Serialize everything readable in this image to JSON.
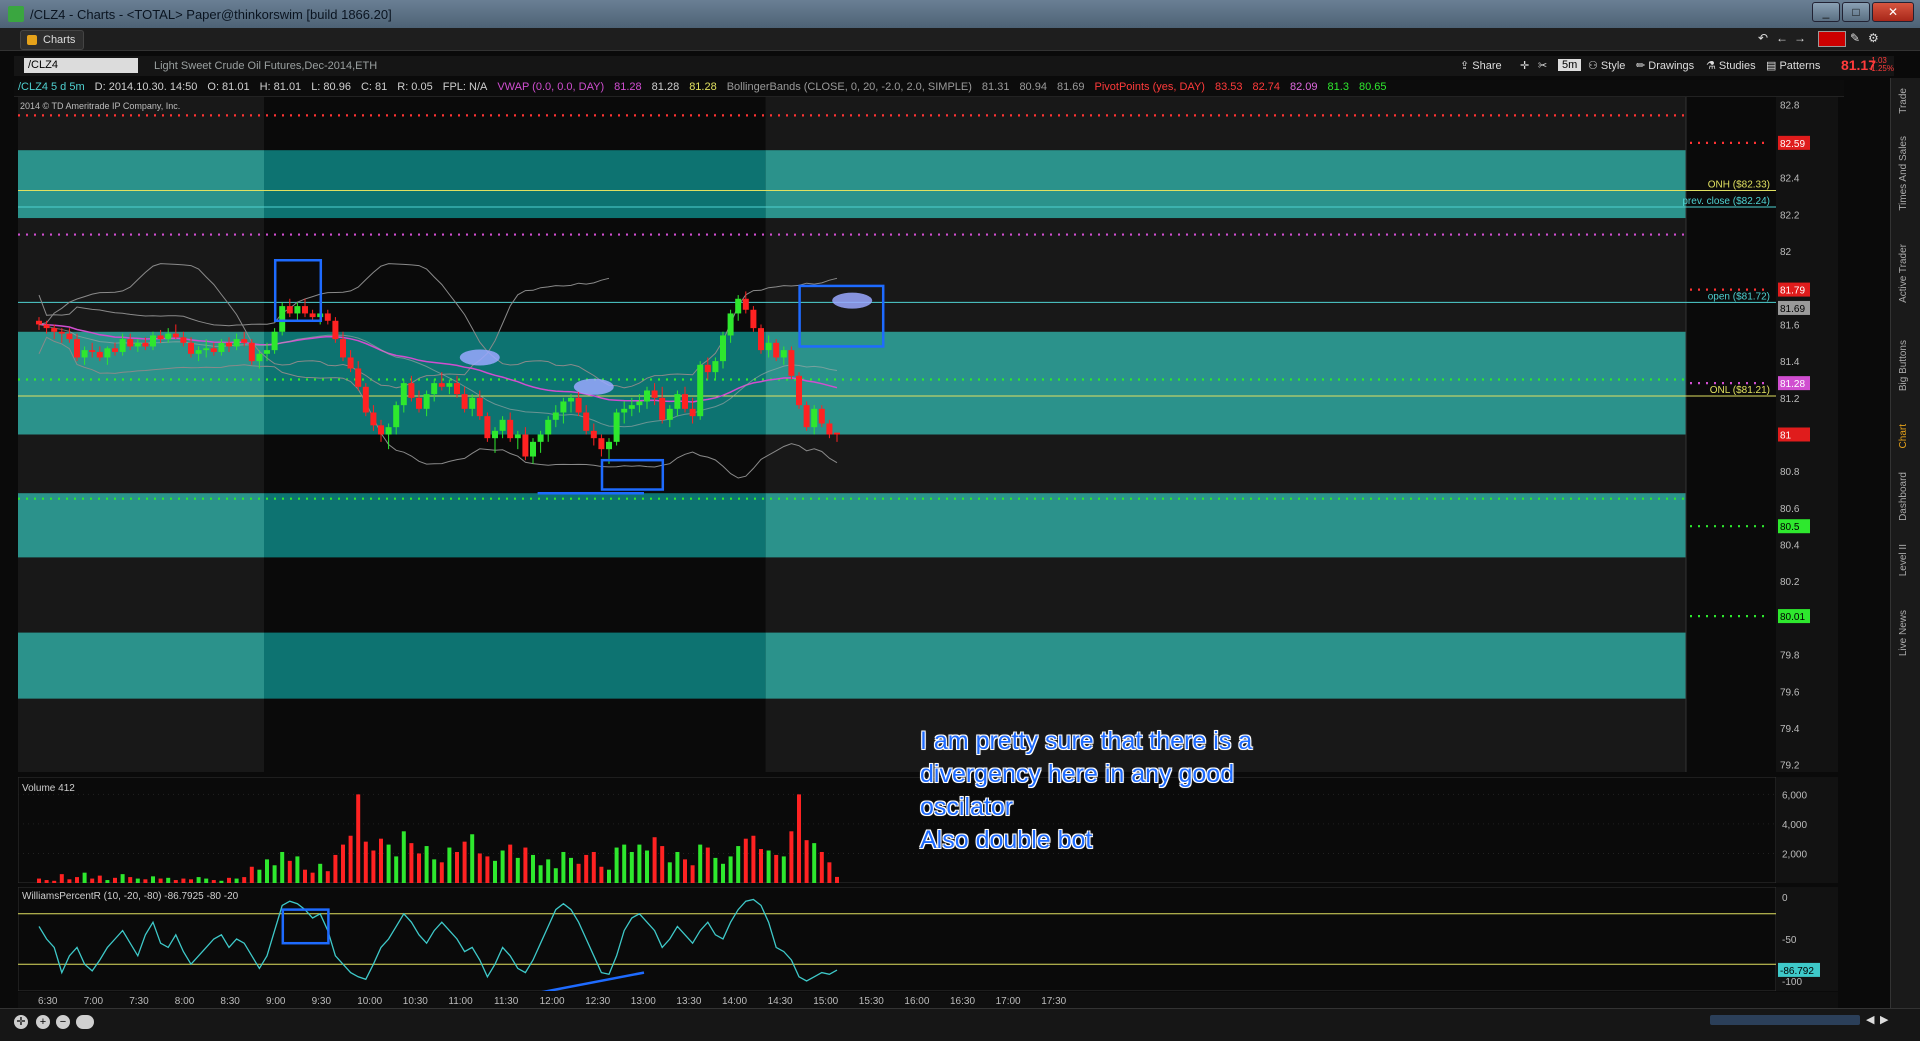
{
  "window": {
    "title": "/CLZ4 - Charts - <TOTAL> Paper@thinkorswim [build 1866.20]"
  },
  "tabs": {
    "charts": "Charts"
  },
  "symbol": {
    "value": "/CLZ4",
    "description": "Light Sweet Crude Oil Futures,Dec-2014,ETH",
    "last_price": "81.17",
    "change_line1": "-1.03",
    "change_line2": "-1.25%"
  },
  "toolbar": {
    "share": "Share",
    "timeframe": "5m",
    "style": "Style",
    "drawings": "Drawings",
    "studies": "Studies",
    "patterns": "Patterns"
  },
  "infobar": {
    "items": [
      {
        "text": "/CLZ4 5 d 5m",
        "color": "#4fd1d1"
      },
      {
        "text": "D: 2014.10.30. 14:50",
        "color": "#cfcfcf"
      },
      {
        "text": "O: 81.01",
        "color": "#cfcfcf"
      },
      {
        "text": "H: 81.01",
        "color": "#cfcfcf"
      },
      {
        "text": "L: 80.96",
        "color": "#cfcfcf"
      },
      {
        "text": "C: 81",
        "color": "#cfcfcf"
      },
      {
        "text": "R: 0.05",
        "color": "#cfcfcf"
      },
      {
        "text": "FPL: N/A",
        "color": "#cfcfcf"
      },
      {
        "text": "VWAP (0.0, 0.0, DAY)",
        "color": "#d04ed0"
      },
      {
        "text": "81.28",
        "color": "#d04ed0"
      },
      {
        "text": "81.28",
        "color": "#cfcfcf"
      },
      {
        "text": "81.28",
        "color": "#e0e060"
      },
      {
        "text": "BollingerBands (CLOSE, 0, 20, -2.0, 2.0, SIMPLE)",
        "color": "#9a9a9a"
      },
      {
        "text": "81.31",
        "color": "#9a9a9a"
      },
      {
        "text": "80.94",
        "color": "#9a9a9a"
      },
      {
        "text": "81.69",
        "color": "#9a9a9a"
      },
      {
        "text": "PivotPoints (yes, DAY)",
        "color": "#ff3b3b"
      },
      {
        "text": "83.53",
        "color": "#ff3b3b"
      },
      {
        "text": "82.74",
        "color": "#ff3b3b"
      },
      {
        "text": "82.09",
        "color": "#e06ae0"
      },
      {
        "text": "81.3",
        "color": "#2ee82e"
      },
      {
        "text": "80.65",
        "color": "#2ee82e"
      }
    ]
  },
  "copyright": "2014 © TD Ameritrade IP Company, Inc.",
  "price_axis": {
    "ticks": [
      "82.8",
      "82.6",
      "82.4",
      "82.2",
      "82",
      "81.8",
      "81.6",
      "81.4",
      "81.2",
      "81",
      "80.8",
      "80.6",
      "80.4",
      "80.2",
      "80",
      "79.8",
      "79.6",
      "79.4",
      "79.2"
    ]
  },
  "price_markers": [
    {
      "label": "82.59",
      "value": 82.59,
      "bg": "#e01c1c",
      "fg": "#ffffff",
      "dot": "#ff3333"
    },
    {
      "label": "81.79",
      "value": 81.79,
      "bg": "#e01c1c",
      "fg": "#ffffff",
      "dot": "#ff3333"
    },
    {
      "label": "81.69",
      "value": 81.69,
      "bg": "#9a9a9a",
      "fg": "#000000",
      "dot": ""
    },
    {
      "label": "81.28",
      "value": 81.28,
      "bg": "#d04ed0",
      "fg": "#ffffff",
      "dot": "#d04ed0"
    },
    {
      "label": "81",
      "value": 81.0,
      "bg": "#e01c1c",
      "fg": "#ffffff",
      "dot": ""
    },
    {
      "label": "80.5",
      "value": 80.5,
      "bg": "#2ee82e",
      "fg": "#000000",
      "dot": "#2ee82e"
    },
    {
      "label": "80.01",
      "value": 80.01,
      "bg": "#2ee82e",
      "fg": "#000000",
      "dot": "#2ee82e"
    }
  ],
  "level_lines": [
    {
      "label": "ONH ($82.33)",
      "value": 82.33,
      "color": "#e0e060"
    },
    {
      "label": "prev. close ($82.24)",
      "value": 82.24,
      "color": "#4fd1d1"
    },
    {
      "label": "open ($81.72)",
      "value": 81.72,
      "color": "#4fd1d1"
    },
    {
      "label": "ONL ($81.21)",
      "value": 81.21,
      "color": "#e0e060"
    }
  ],
  "time_axis": {
    "ticks": [
      "6:30",
      "7:00",
      "7:30",
      "8:00",
      "8:30",
      "9:00",
      "9:30",
      "10:00",
      "10:30",
      "11:00",
      "11:30",
      "12:00",
      "12:30",
      "13:00",
      "13:30",
      "14:00",
      "14:30",
      "15:00",
      "15:30",
      "16:00",
      "16:30",
      "17:00",
      "17:30"
    ]
  },
  "volume": {
    "label": "Volume",
    "value": "412",
    "ticks": [
      "6,000",
      "4,000",
      "2,000"
    ]
  },
  "williams": {
    "label": "WilliamsPercentR (10, -20, -80)",
    "value": "-86.7925",
    "low": "-80",
    "high": "-20",
    "ticks": [
      "0",
      "-50",
      "-100"
    ],
    "badge": "-86.792"
  },
  "annotation": {
    "lines": [
      "I am pretty sure that there is a",
      "divergency here in any good",
      "oscilator",
      "Also double bot"
    ]
  },
  "side_tabs": [
    "Trade",
    "Times And Sales",
    "Active Trader",
    "Big Buttons",
    "Chart",
    "Dashboard",
    "Level II",
    "Live News"
  ],
  "colors": {
    "up": "#2ee82e",
    "down": "#ff2222",
    "teal_band": "#1e8c84",
    "rth_band": "#0d7371",
    "vwap": "#d04ed0",
    "bollinger": "#8a8a8a",
    "williams": "#3ec9c9",
    "annotation": "#1e6bff"
  },
  "chart_data": {
    "type": "candlestick",
    "bar_interval": "5m",
    "start_time": "6:30",
    "ohlc": [
      [
        81.62,
        81.64,
        81.57,
        81.6
      ],
      [
        81.6,
        81.62,
        81.55,
        81.58
      ],
      [
        81.58,
        81.6,
        81.52,
        81.56
      ],
      [
        81.56,
        81.58,
        81.5,
        81.55
      ],
      [
        81.55,
        81.58,
        81.5,
        81.52
      ],
      [
        81.52,
        81.55,
        81.4,
        81.42
      ],
      [
        81.42,
        81.48,
        81.38,
        81.46
      ],
      [
        81.46,
        81.5,
        81.42,
        81.45
      ],
      [
        81.45,
        81.48,
        81.4,
        81.42
      ],
      [
        81.42,
        81.48,
        81.38,
        81.47
      ],
      [
        81.47,
        81.5,
        81.43,
        81.45
      ],
      [
        81.45,
        81.55,
        81.43,
        81.52
      ],
      [
        81.52,
        81.55,
        81.46,
        81.48
      ],
      [
        81.48,
        81.52,
        81.45,
        81.5
      ],
      [
        81.5,
        81.53,
        81.46,
        81.48
      ],
      [
        81.48,
        81.56,
        81.46,
        81.54
      ],
      [
        81.54,
        81.57,
        81.5,
        81.52
      ],
      [
        81.52,
        81.58,
        81.5,
        81.55
      ],
      [
        81.55,
        81.6,
        81.52,
        81.53
      ],
      [
        81.53,
        81.56,
        81.48,
        81.5
      ],
      [
        81.5,
        81.53,
        81.42,
        81.44
      ],
      [
        81.44,
        81.48,
        81.4,
        81.46
      ],
      [
        81.46,
        81.52,
        81.42,
        81.47
      ],
      [
        81.47,
        81.5,
        81.43,
        81.45
      ],
      [
        81.45,
        81.52,
        81.43,
        81.5
      ],
      [
        81.5,
        81.53,
        81.45,
        81.48
      ],
      [
        81.48,
        81.55,
        81.46,
        81.52
      ],
      [
        81.52,
        81.56,
        81.48,
        81.5
      ],
      [
        81.5,
        81.52,
        81.38,
        81.4
      ],
      [
        81.4,
        81.46,
        81.36,
        81.44
      ],
      [
        81.44,
        81.5,
        81.4,
        81.46
      ],
      [
        81.46,
        81.58,
        81.44,
        81.56
      ],
      [
        81.56,
        81.72,
        81.54,
        81.7
      ],
      [
        81.7,
        81.74,
        81.64,
        81.66
      ],
      [
        81.66,
        81.72,
        81.62,
        81.7
      ],
      [
        81.7,
        81.74,
        81.64,
        81.66
      ],
      [
        81.66,
        81.68,
        81.62,
        81.64
      ],
      [
        81.64,
        81.68,
        81.6,
        81.66
      ],
      [
        81.66,
        81.68,
        81.6,
        81.62
      ],
      [
        81.62,
        81.64,
        81.5,
        81.52
      ],
      [
        81.52,
        81.56,
        81.4,
        81.42
      ],
      [
        81.42,
        81.46,
        81.34,
        81.36
      ],
      [
        81.36,
        81.4,
        81.24,
        81.26
      ],
      [
        81.26,
        81.28,
        81.1,
        81.12
      ],
      [
        81.12,
        81.16,
        81.02,
        81.05
      ],
      [
        81.05,
        81.08,
        80.96,
        81.0
      ],
      [
        81.0,
        81.06,
        80.92,
        81.04
      ],
      [
        81.04,
        81.18,
        81.0,
        81.16
      ],
      [
        81.16,
        81.3,
        81.12,
        81.28
      ],
      [
        81.28,
        81.32,
        81.18,
        81.2
      ],
      [
        81.2,
        81.24,
        81.12,
        81.14
      ],
      [
        81.14,
        81.24,
        81.1,
        81.22
      ],
      [
        81.22,
        81.3,
        81.18,
        81.28
      ],
      [
        81.28,
        81.34,
        81.24,
        81.26
      ],
      [
        81.26,
        81.3,
        81.22,
        81.28
      ],
      [
        81.28,
        81.32,
        81.2,
        81.22
      ],
      [
        81.22,
        81.26,
        81.12,
        81.14
      ],
      [
        81.14,
        81.22,
        81.1,
        81.2
      ],
      [
        81.2,
        81.24,
        81.08,
        81.1
      ],
      [
        81.1,
        81.12,
        80.96,
        80.98
      ],
      [
        80.98,
        81.04,
        80.9,
        81.02
      ],
      [
        81.02,
        81.1,
        80.98,
        81.08
      ],
      [
        81.08,
        81.12,
        80.96,
        80.98
      ],
      [
        80.98,
        81.02,
        80.92,
        81.0
      ],
      [
        81.0,
        81.04,
        80.86,
        80.88
      ],
      [
        80.88,
        80.98,
        80.84,
        80.96
      ],
      [
        80.96,
        81.02,
        80.9,
        81.0
      ],
      [
        81.0,
        81.1,
        80.96,
        81.08
      ],
      [
        81.08,
        81.16,
        81.04,
        81.12
      ],
      [
        81.12,
        81.2,
        81.06,
        81.18
      ],
      [
        81.18,
        81.22,
        81.12,
        81.2
      ],
      [
        81.2,
        81.24,
        81.1,
        81.12
      ],
      [
        81.12,
        81.16,
        81.0,
        81.02
      ],
      [
        81.02,
        81.06,
        80.94,
        80.98
      ],
      [
        80.98,
        81.0,
        80.88,
        80.92
      ],
      [
        80.92,
        80.98,
        80.84,
        80.96
      ],
      [
        80.96,
        81.14,
        80.94,
        81.12
      ],
      [
        81.12,
        81.18,
        81.06,
        81.14
      ],
      [
        81.14,
        81.2,
        81.1,
        81.16
      ],
      [
        81.16,
        81.22,
        81.12,
        81.18
      ],
      [
        81.18,
        81.26,
        81.14,
        81.24
      ],
      [
        81.24,
        81.28,
        81.16,
        81.2
      ],
      [
        81.2,
        81.26,
        81.06,
        81.08
      ],
      [
        81.08,
        81.16,
        81.04,
        81.14
      ],
      [
        81.14,
        81.24,
        81.1,
        81.22
      ],
      [
        81.22,
        81.26,
        81.12,
        81.14
      ],
      [
        81.14,
        81.2,
        81.06,
        81.1
      ],
      [
        81.1,
        81.4,
        81.08,
        81.38
      ],
      [
        81.38,
        81.42,
        81.3,
        81.34
      ],
      [
        81.34,
        81.42,
        81.3,
        81.4
      ],
      [
        81.4,
        81.56,
        81.36,
        81.54
      ],
      [
        81.54,
        81.68,
        81.5,
        81.66
      ],
      [
        81.66,
        81.76,
        81.62,
        81.74
      ],
      [
        81.74,
        81.78,
        81.66,
        81.68
      ],
      [
        81.68,
        81.7,
        81.56,
        81.58
      ],
      [
        81.58,
        81.6,
        81.44,
        81.46
      ],
      [
        81.46,
        81.54,
        81.42,
        81.5
      ],
      [
        81.5,
        81.52,
        81.4,
        81.42
      ],
      [
        81.42,
        81.48,
        81.38,
        81.46
      ],
      [
        81.46,
        81.48,
        81.3,
        81.32
      ],
      [
        81.32,
        81.34,
        81.14,
        81.16
      ],
      [
        81.16,
        81.18,
        81.02,
        81.04
      ],
      [
        81.04,
        81.16,
        81.0,
        81.14
      ],
      [
        81.14,
        81.16,
        81.04,
        81.06
      ],
      [
        81.06,
        81.08,
        80.98,
        81.0
      ],
      [
        81.01,
        81.01,
        80.96,
        81.0
      ]
    ],
    "volume": [
      300,
      200,
      150,
      600,
      250,
      400,
      700,
      300,
      500,
      200,
      350,
      600,
      400,
      300,
      250,
      450,
      300,
      350,
      200,
      300,
      250,
      400,
      300,
      200,
      150,
      350,
      300,
      400,
      1100,
      900,
      1600,
      1200,
      2100,
      1500,
      1800,
      900,
      700,
      1300,
      800,
      1900,
      2600,
      3200,
      6000,
      2800,
      2200,
      3000,
      2600,
      1800,
      3500,
      2700,
      2000,
      2500,
      1600,
      1400,
      2400,
      2100,
      2800,
      3300,
      2000,
      1800,
      1500,
      2200,
      2600,
      1700,
      2400,
      1900,
      1200,
      1600,
      1000,
      2100,
      1700,
      1300,
      1900,
      2100,
      1100,
      900,
      2400,
      2600,
      2100,
      2600,
      2200,
      3100,
      2500,
      1400,
      2100,
      1600,
      1200,
      2600,
      2400,
      1700,
      1300,
      1800,
      2500,
      3000,
      3200,
      2300,
      2200,
      1900,
      1800,
      3500,
      6000,
      2900,
      2700,
      2100,
      1400,
      412
    ],
    "williams_r": [
      -35,
      -50,
      -60,
      -90,
      -70,
      -60,
      -80,
      -88,
      -75,
      -60,
      -50,
      -40,
      -55,
      -70,
      -45,
      -30,
      -55,
      -60,
      -45,
      -65,
      -80,
      -70,
      -60,
      -50,
      -45,
      -60,
      -50,
      -55,
      -70,
      -85,
      -70,
      -40,
      -10,
      -5,
      -8,
      -15,
      -25,
      -20,
      -40,
      -70,
      -80,
      -90,
      -95,
      -98,
      -80,
      -60,
      -50,
      -35,
      -20,
      -30,
      -45,
      -55,
      -40,
      -30,
      -40,
      -50,
      -65,
      -60,
      -75,
      -95,
      -80,
      -60,
      -70,
      -85,
      -90,
      -75,
      -55,
      -35,
      -15,
      -8,
      -15,
      -30,
      -50,
      -70,
      -90,
      -92,
      -70,
      -40,
      -25,
      -20,
      -30,
      -40,
      -60,
      -50,
      -35,
      -45,
      -55,
      -40,
      -30,
      -45,
      -50,
      -30,
      -15,
      -5,
      -3,
      -10,
      -30,
      -60,
      -65,
      -75,
      -95,
      -100,
      -95,
      -90,
      -92,
      -87
    ]
  }
}
